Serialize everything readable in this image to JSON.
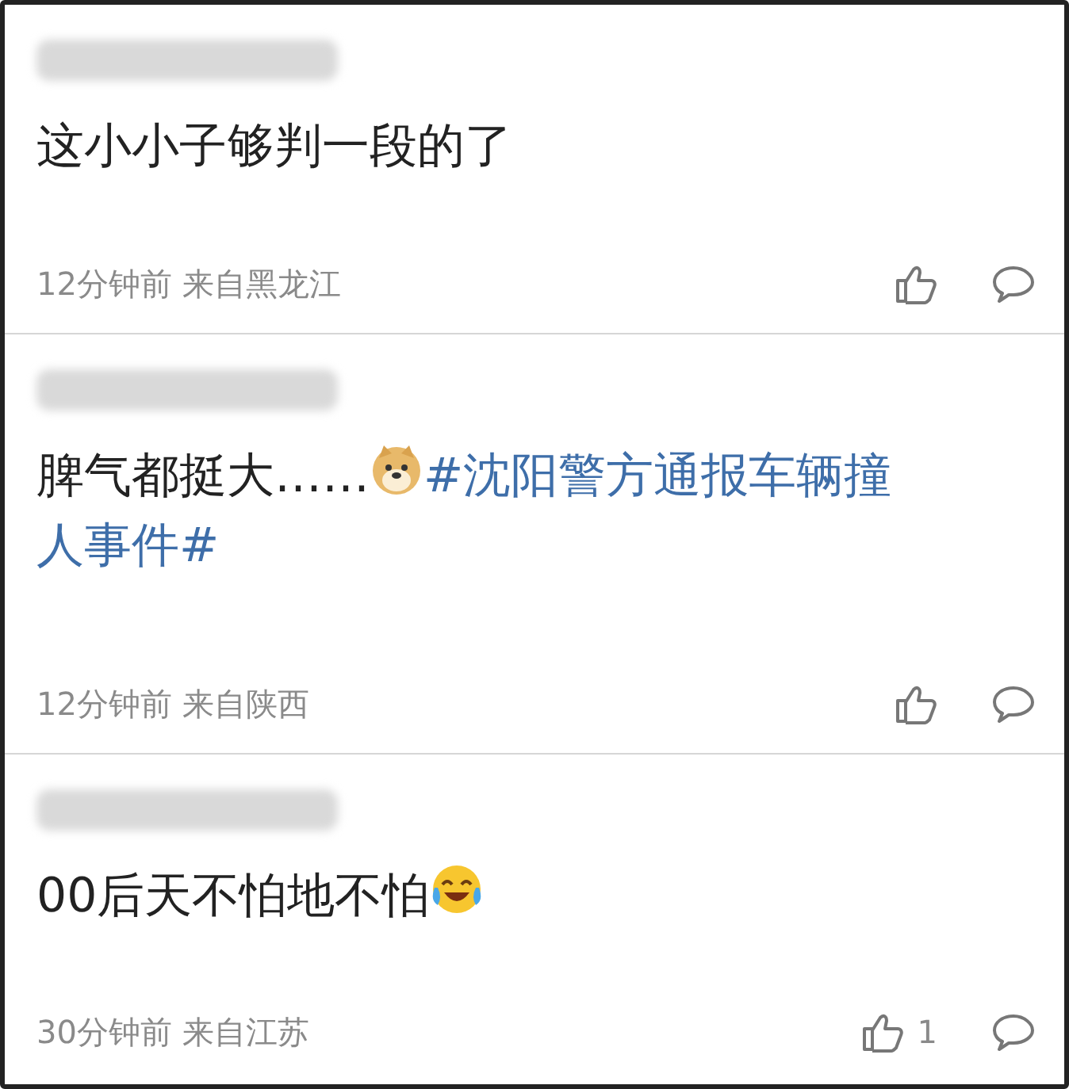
{
  "comments": [
    {
      "parts": [
        {
          "kind": "text",
          "text": "这小小子够判一段的了"
        }
      ],
      "time": "12分钟前",
      "location": "来自黑龙江"
    },
    {
      "parts": [
        {
          "kind": "text",
          "text": "脾气都挺大……"
        },
        {
          "kind": "emoji_doge"
        },
        {
          "kind": "hashtag",
          "lines": [
            "#沈阳警方通报车辆撞",
            "人事件#"
          ]
        }
      ],
      "time": "12分钟前",
      "location": "来自陕西"
    },
    {
      "parts": [
        {
          "kind": "text",
          "text": "00后天不怕地不怕"
        },
        {
          "kind": "emoji_laugh"
        }
      ],
      "time": "30分钟前",
      "location": "来自江苏",
      "likes": "1"
    }
  ]
}
